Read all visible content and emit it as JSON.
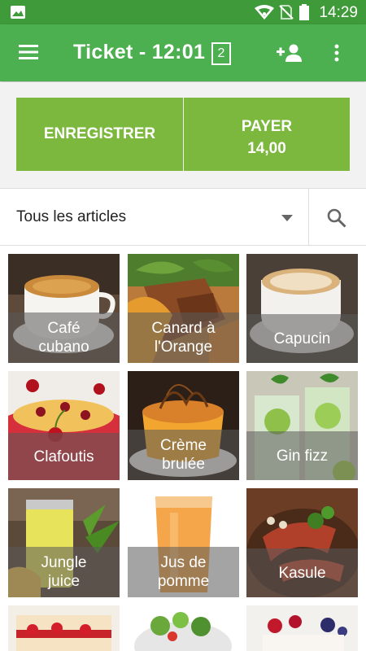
{
  "status_bar": {
    "time": "14:29"
  },
  "app_bar": {
    "title": "Ticket - 12:01",
    "ticket_count": "2"
  },
  "actions": {
    "save_label": "ENREGISTRER",
    "pay_label": "PAYER",
    "pay_amount": "14,00"
  },
  "filter": {
    "selected": "Tous les articles"
  },
  "items": [
    {
      "name": "Café\ncubano"
    },
    {
      "name": "Canard à\nl'Orange"
    },
    {
      "name": "Capucin"
    },
    {
      "name": "Clafoutis"
    },
    {
      "name": "Crème\nbrulée"
    },
    {
      "name": "Gin fizz"
    },
    {
      "name": "Jungle\njuice"
    },
    {
      "name": "Jus de\npomme"
    },
    {
      "name": "Kasule"
    }
  ],
  "colors": {
    "primary": "#4caf50",
    "status_bar": "#3f9b3a",
    "button": "#7cb83e"
  },
  "icons": [
    "image-icon",
    "wifi-icon",
    "no-sim-icon",
    "battery-icon",
    "menu-icon",
    "ticket-icon",
    "add-person-icon",
    "more-vert-icon",
    "dropdown-arrow-icon",
    "search-icon"
  ]
}
